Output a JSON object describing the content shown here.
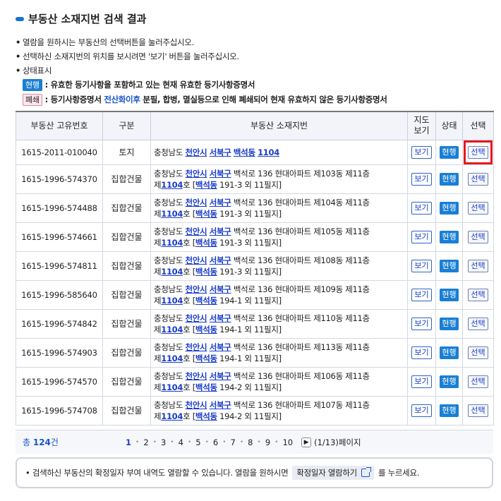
{
  "page_title": "부동산 소재지번 검색 결과",
  "notes": [
    "열람을 원하시는 부동산의 선택버튼을 눌러주십시오.",
    "선택하신 소재지번의 위치를 보시려면 '보기' 버튼을 눌러주십시오.",
    "상태표시"
  ],
  "legend": {
    "current_badge": "현행",
    "current_desc": ": 유효한 등기사항을 포함하고 있는 현재 유효한 등기사항증명서",
    "closed_badge": "폐쇄",
    "closed_desc_1": ": 등기사항증명서 ",
    "closed_desc_hl": "전산화이후",
    "closed_desc_2": " 분필, 합병, 멸실등으로 인해 폐쇄되어 현재 유효하지 않은 등기사항증명서"
  },
  "table": {
    "headers": {
      "no": "부동산 고유번호",
      "type": "구분",
      "addr": "부동산 소재지번",
      "map_1": "지도",
      "map_2": "보기",
      "status": "상태",
      "select": "선택"
    },
    "view_label": "보기",
    "status_label": "현행",
    "select_label": "선택",
    "rows": [
      {
        "no": "1615-2011-010040",
        "type": "토지",
        "prefix": "충청남도 ",
        "city": "천안시",
        "gu": "서북구",
        "dong": "백석동",
        "jibun": "1104"
      },
      {
        "no": "1615-1996-574370",
        "type": "집합건물",
        "prefix": "충청남도 ",
        "city": "천안시",
        "gu": "서북구",
        "line1_rest": " 백석로 136 현대아파트 제103동 제11층",
        "l2_pre": "제",
        "l2_ho": "1104",
        "l2_mid": "호 [",
        "l2_dong": "백석동",
        "l2_rest": " 191-3 외 11필지]"
      },
      {
        "no": "1615-1996-574488",
        "type": "집합건물",
        "prefix": "충청남도 ",
        "city": "천안시",
        "gu": "서북구",
        "line1_rest": " 백석로 136 현대아파트 제104동 제11층",
        "l2_pre": "제",
        "l2_ho": "1104",
        "l2_mid": "호 [",
        "l2_dong": "백석동",
        "l2_rest": " 191-3 외 11필지]"
      },
      {
        "no": "1615-1996-574661",
        "type": "집합건물",
        "prefix": "충청남도 ",
        "city": "천안시",
        "gu": "서북구",
        "line1_rest": " 백석로 136 현대아파트 제105동 제11층",
        "l2_pre": "제",
        "l2_ho": "1104",
        "l2_mid": "호 [",
        "l2_dong": "백석동",
        "l2_rest": " 191-3 외 11필지]"
      },
      {
        "no": "1615-1996-574811",
        "type": "집합건물",
        "prefix": "충청남도 ",
        "city": "천안시",
        "gu": "서북구",
        "line1_rest": " 백석로 136 현대아파트 제108동 제11층",
        "l2_pre": "제",
        "l2_ho": "1104",
        "l2_mid": "호 [",
        "l2_dong": "백석동",
        "l2_rest": " 191-3 외 11필지]"
      },
      {
        "no": "1615-1996-585640",
        "type": "집합건물",
        "prefix": "충청남도 ",
        "city": "천안시",
        "gu": "서북구",
        "line1_rest": " 백석로 136 현대아파트 제109동 제11층",
        "l2_pre": "제",
        "l2_ho": "1104",
        "l2_mid": "호 [",
        "l2_dong": "백석동",
        "l2_rest": " 194-1 외 11필지]"
      },
      {
        "no": "1615-1996-574842",
        "type": "집합건물",
        "prefix": "충청남도 ",
        "city": "천안시",
        "gu": "서북구",
        "line1_rest": " 백석로 136 현대아파트 제110동 제11층",
        "l2_pre": "제",
        "l2_ho": "1104",
        "l2_mid": "호 [",
        "l2_dong": "백석동",
        "l2_rest": " 194-1 외 11필지]"
      },
      {
        "no": "1615-1996-574903",
        "type": "집합건물",
        "prefix": "충청남도 ",
        "city": "천안시",
        "gu": "서북구",
        "line1_rest": " 백석로 136 현대아파트 제113동 제11층",
        "l2_pre": "제",
        "l2_ho": "1104",
        "l2_mid": "호 [",
        "l2_dong": "백석동",
        "l2_rest": " 194-1 외 11필지]"
      },
      {
        "no": "1615-1996-574570",
        "type": "집합건물",
        "prefix": "충청남도 ",
        "city": "천안시",
        "gu": "서북구",
        "line1_rest": " 백석로 136 현대아파트 제106동 제11층",
        "l2_pre": "제",
        "l2_ho": "1104",
        "l2_mid": "호 [",
        "l2_dong": "백석동",
        "l2_rest": " 194-2 외 11필지]"
      },
      {
        "no": "1615-1996-574708",
        "type": "집합건물",
        "prefix": "충청남도 ",
        "city": "천안시",
        "gu": "서북구",
        "line1_rest": " 백석로 136 현대아파트 제107동 제11층",
        "l2_pre": "제",
        "l2_ho": "1104",
        "l2_mid": "호 [",
        "l2_dong": "백석동",
        "l2_rest": " 194-2 외 11필지]"
      }
    ]
  },
  "pager": {
    "total_prefix": "총 ",
    "total_count": "124",
    "total_suffix": "건",
    "pages": [
      "1",
      "2",
      "3",
      "4",
      "5",
      "6",
      "7",
      "8",
      "9",
      "10"
    ],
    "active_page": "1",
    "next_icon": "chevron-right-icon",
    "page_info": "(1/13)페이지"
  },
  "info": {
    "text_1": "검색하신 부동산의 확정일자 부여 내역도 열람할 수 있습니다. 열람을 원하시면",
    "button_label": "확정일자 열람하기",
    "button_icon": "external-link-icon",
    "text_2": "를 누르세요."
  },
  "colors": {
    "accent_blue": "#1a7fd4",
    "link_blue": "#1a3cc8",
    "highlight_red": "#e8181e"
  }
}
